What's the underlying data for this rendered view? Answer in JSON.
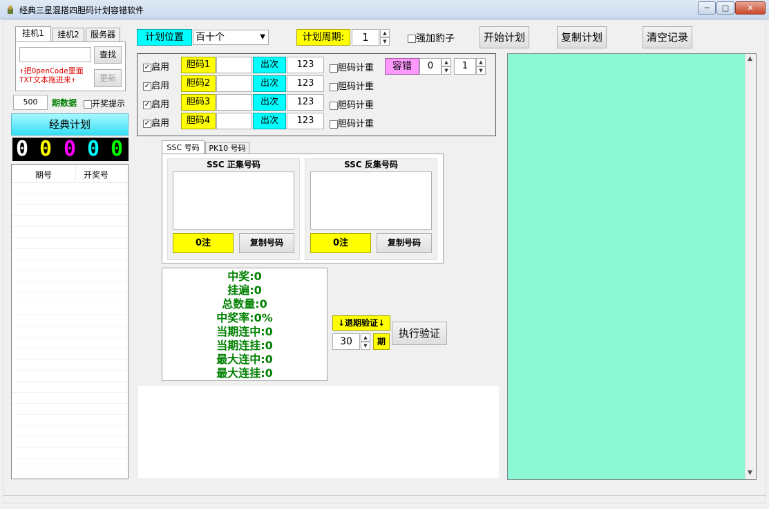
{
  "window": {
    "title": "经典三星混搭四胆码计划容错软件",
    "min": "─",
    "max": "□",
    "close": "✕"
  },
  "left_tabs": [
    "挂机1",
    "挂机2",
    "服务器"
  ],
  "left": {
    "search_btn": "查找",
    "hint": "↑把OpenCode里面TXT文本拖进来↑",
    "update_btn": "更新",
    "periods": "500",
    "periods_label": "期数据",
    "open_hint": "开奖提示",
    "classic": "经典计划",
    "digits": [
      "0",
      "0",
      "0",
      "0",
      "0"
    ],
    "table_headers": [
      "期号",
      "开奖号"
    ]
  },
  "plan": {
    "pos_label": "计划位置",
    "pos_value": "百十个",
    "cycle_label": "计划周期:",
    "cycle_value": "1",
    "force": "强加豹子",
    "start": "开始计划",
    "copy": "复制计划",
    "clear": "清空记录"
  },
  "rows": [
    {
      "enable": "启用",
      "name": "胆码1",
      "times": "出次",
      "value": "123",
      "repeat": "胆码计重"
    },
    {
      "enable": "启用",
      "name": "胆码2",
      "times": "出次",
      "value": "123",
      "repeat": "胆码计重"
    },
    {
      "enable": "启用",
      "name": "胆码3",
      "times": "出次",
      "value": "123",
      "repeat": "胆码计重"
    },
    {
      "enable": "启用",
      "name": "胆码4",
      "times": "出次",
      "value": "123",
      "repeat": "胆码计重"
    }
  ],
  "tolerance": {
    "label": "容错",
    "v1": "0",
    "v2": "1"
  },
  "num_tabs": [
    "SSC 号码",
    "PK10 号码"
  ],
  "pos_group": {
    "title": "SSC 正集号码",
    "count": "0注",
    "copy": "复制号码"
  },
  "neg_group": {
    "title": "SSC 反集号码",
    "count": "0注",
    "copy": "复制号码"
  },
  "stats": [
    "中奖:0",
    "挂遍:0",
    "总数量:0",
    "中奖率:0%",
    "当期连中:0",
    "当期连挂:0",
    "最大连中:0",
    "最大连挂:0"
  ],
  "verify": {
    "back": "↓退期验证↓",
    "periods": "30",
    "unit": "期",
    "run": "执行验证"
  },
  "colors": {
    "result": "#8cf8d4",
    "yellow": "#ffff00",
    "cyan": "#00ffff",
    "pink": "#ff99ff",
    "digits": [
      "#ffffff",
      "#ffff00",
      "#ff00ff",
      "#00ffff",
      "#00ff00"
    ]
  }
}
